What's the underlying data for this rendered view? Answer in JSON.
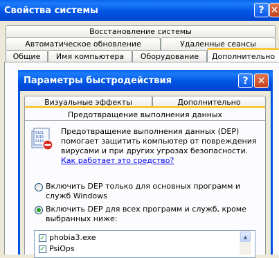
{
  "outer_window": {
    "title": "Свойства системы",
    "help_glyph": "?",
    "close_glyph": "✕",
    "tabs_row1": [
      "Восстановление системы"
    ],
    "tabs_row2": [
      "Автоматическое обновление",
      "Удаленные сеансы"
    ],
    "tabs_row3": [
      "Общие",
      "Имя компьютера",
      "Оборудование",
      "Дополнительно"
    ],
    "active_tab": "Дополнительно"
  },
  "dialog": {
    "title": "Параметры быстродействия",
    "help_glyph": "?",
    "close_glyph": "✕",
    "tabs": [
      "Визуальные эффекты",
      "Дополнительно",
      "Предотвращение выполнения данных"
    ],
    "active_tab": "Предотвращение выполнения данных",
    "icon": "dep-shield-icon",
    "description": "Предотвращение выполнения данных (DEP) помогает защитить компьютер от повреждения вирусами и при других угрозах безопасности.",
    "link": "Как работает это средство?",
    "option1": "Включить DEP только для основных программ и служб Windows",
    "option2": "Включить DEP для всех программ и служб, кроме выбранных ниже:",
    "selected_option": 2,
    "exceptions": [
      {
        "name": "phobia3.exe",
        "checked": true
      },
      {
        "name": "PsiOps",
        "checked": true
      }
    ],
    "scroll_up_glyph": "▲",
    "check_glyph": "✓"
  },
  "colors": {
    "face": "#ECE9D8",
    "titlebar": "#0055E5",
    "tab_accent": "#FFC83C",
    "check": "#21A121"
  }
}
